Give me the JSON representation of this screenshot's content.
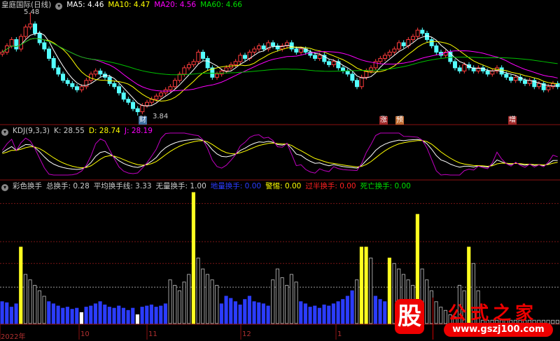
{
  "header": {
    "stock": "皇庭国际(日线)",
    "ma5": "MA5: 4.46",
    "ma10": "MA10: 4.47",
    "ma20": "MA20: 4.56",
    "ma60": "MA60: 4.66"
  },
  "kdj_header": {
    "name": "KDJ(9,3,3)",
    "k": "K: 28.55",
    "d": "D: 28.74",
    "j": "J: 28.19"
  },
  "turnover_header": {
    "name": "彩色换手",
    "total": "总换手: 0.28",
    "avg": "平均换手线: 3.33",
    "none": "无量换手: 1.00",
    "low": "地量换手: 0.00",
    "warn": "警惕: 0.00",
    "half": "过半换手: 0.00",
    "dead": "死亡换手: 0.00"
  },
  "annotations": {
    "high": "5.48",
    "low": "3.84",
    "tag_cai": "财",
    "tag_zhang": "涨",
    "tag_yu": "预",
    "tag_zeng": "增"
  },
  "dates": [
    "2022年",
    "10",
    "11",
    "12",
    "1"
  ],
  "watermark": {
    "badge": "股",
    "name": "公式之家",
    "url": "www.gszj100.com"
  },
  "colors": {
    "up": "#ff3c3c",
    "down": "#54ffff",
    "ma5": "#ffffff",
    "ma10": "#ffff00",
    "ma20": "#ff00ff",
    "ma60": "#00c000",
    "blue": "#2b3cff",
    "yellow": "#ffff20",
    "gray": "#a0a0a0",
    "white": "#ffffff"
  },
  "chart_data": {
    "type": "candlestick+line+bar",
    "price_range": [
      3.84,
      5.48
    ],
    "high_index": 6,
    "low_index": 29,
    "closes": [
      4.85,
      4.95,
      5.05,
      4.9,
      5.1,
      5.25,
      5.3,
      5.15,
      5.0,
      4.9,
      4.75,
      4.6,
      4.5,
      4.4,
      4.35,
      4.3,
      4.25,
      4.3,
      4.4,
      4.5,
      4.55,
      4.5,
      4.45,
      4.35,
      4.3,
      4.2,
      4.1,
      4.05,
      3.95,
      3.9,
      4.0,
      4.05,
      4.1,
      4.15,
      4.2,
      4.25,
      4.3,
      4.4,
      4.5,
      4.6,
      4.65,
      4.7,
      4.85,
      4.75,
      4.6,
      4.45,
      4.5,
      4.55,
      4.6,
      4.65,
      4.7,
      4.8,
      4.75,
      4.85,
      4.9,
      4.95,
      4.9,
      5.0,
      4.95,
      4.9,
      4.95,
      5.0,
      4.9,
      4.85,
      4.9,
      4.85,
      4.8,
      4.75,
      4.8,
      4.7,
      4.65,
      4.7,
      4.6,
      4.55,
      4.5,
      4.4,
      4.3,
      4.45,
      4.55,
      4.6,
      4.7,
      4.75,
      4.8,
      4.85,
      4.9,
      5.0,
      4.95,
      5.05,
      5.1,
      5.2,
      5.15,
      5.05,
      4.95,
      4.85,
      4.8,
      4.85,
      4.7,
      4.6,
      4.55,
      4.65,
      4.6,
      4.55,
      4.6,
      4.55,
      4.5,
      4.55,
      4.6,
      4.5,
      4.45,
      4.4,
      4.45,
      4.4,
      4.35,
      4.4,
      4.3,
      4.35,
      4.25,
      4.3,
      4.35,
      4.3
    ],
    "turnover": [
      2.0,
      1.9,
      1.5,
      1.8,
      7.0,
      4.5,
      4.0,
      3.5,
      3.0,
      2.5,
      2.0,
      1.8,
      1.6,
      1.4,
      1.5,
      1.3,
      1.4,
      1.0,
      1.5,
      1.6,
      1.8,
      2.0,
      1.7,
      1.5,
      1.4,
      1.6,
      1.4,
      1.2,
      1.4,
      0.8,
      1.5,
      1.6,
      1.7,
      1.5,
      1.6,
      1.8,
      4.0,
      3.5,
      3.0,
      3.8,
      4.5,
      12,
      6,
      5,
      4.5,
      4,
      3.5,
      1.8,
      2.5,
      2.3,
      2.0,
      1.7,
      2.2,
      2.5,
      2.0,
      1.9,
      1.8,
      1.6,
      4.0,
      5.0,
      4.2,
      3.5,
      4.5,
      3.8,
      2.0,
      1.8,
      1.5,
      1.6,
      1.4,
      1.7,
      1.6,
      1.8,
      2.0,
      2.2,
      2.5,
      3.0,
      4.0,
      7.0,
      7.0,
      6.0,
      2.5,
      2.2,
      2.0,
      6.0,
      5.5,
      5.0,
      4.5,
      4.0,
      3.5,
      10,
      5,
      4,
      3,
      2,
      1.5,
      1.2,
      0.8,
      0.6,
      3.5,
      3.0,
      7.0,
      5.5,
      3.0,
      0.3,
      0.3,
      0.3,
      0.3,
      0.3,
      0.3,
      0.3,
      0.3,
      0.3,
      0.3,
      0.3,
      0.3,
      0.3,
      0.3,
      0.3,
      0.3,
      0.3
    ],
    "turnover_kind": "bbbbygggggbbbbbbbwbbbbbbbbbbbwbbbbbbgggggygggggbbbbbbbbbbbggggggbbbbbbbbbbbbgyygbbbygggggyggggggggggyggggggggggggggggggg",
    "turnover_avg": 3.33,
    "turnover_max": 12
  }
}
